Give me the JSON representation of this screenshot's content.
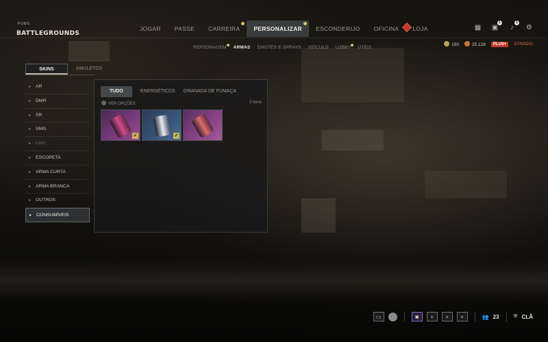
{
  "logo": {
    "small": "PUBG",
    "big": "BATTLEGROUNDS"
  },
  "main_nav": [
    {
      "label": "JOGAR",
      "active": false,
      "dot": false
    },
    {
      "label": "PASSE",
      "active": false,
      "dot": false
    },
    {
      "label": "CARREIRA",
      "active": false,
      "dot": true
    },
    {
      "label": "PERSONALIZAR",
      "active": true,
      "dot": true
    },
    {
      "label": "ESCONDERIJO",
      "active": false,
      "dot": false
    },
    {
      "label": "OFICINA",
      "active": false,
      "dot": false
    },
    {
      "label": "LOJA",
      "active": false,
      "dot": false
    }
  ],
  "top_icons": [
    {
      "name": "grid-icon",
      "glyph": "▦",
      "badge": ""
    },
    {
      "name": "mail-icon",
      "glyph": "▣",
      "badge": "1"
    },
    {
      "name": "bell-icon",
      "glyph": "♪",
      "badge": "1"
    },
    {
      "name": "gear-icon",
      "glyph": "⚙",
      "badge": ""
    }
  ],
  "sub_nav": [
    {
      "label": "PERSONAGEM",
      "active": false,
      "dot": true
    },
    {
      "label": "ARMAS",
      "active": true,
      "dot": false
    },
    {
      "label": "EMOTES E SPRAYS",
      "active": false,
      "dot": false
    },
    {
      "label": "VEÍCULO",
      "active": false,
      "dot": false
    },
    {
      "label": "LOBBY",
      "active": false,
      "dot": true
    },
    {
      "label": "ÚTEIS",
      "active": false,
      "dot": false
    }
  ],
  "currency": {
    "coins": "150",
    "bp": "25.128",
    "plus_label": "PLUS+",
    "plus_status": "ATIVADO"
  },
  "left_tabs": [
    {
      "label": "SKINS",
      "active": true
    },
    {
      "label": "AMULETOS",
      "active": false
    }
  ],
  "categories": [
    {
      "label": "AR",
      "active": false,
      "disabled": false
    },
    {
      "label": "DMR",
      "active": false,
      "disabled": false
    },
    {
      "label": "SR",
      "active": false,
      "disabled": false
    },
    {
      "label": "SMG",
      "active": false,
      "disabled": false
    },
    {
      "label": "LMG",
      "active": false,
      "disabled": true
    },
    {
      "label": "ESCOPETA",
      "active": false,
      "disabled": false
    },
    {
      "label": "ARMA CURTA",
      "active": false,
      "disabled": false
    },
    {
      "label": "ARMA BRANCA",
      "active": false,
      "disabled": false
    },
    {
      "label": "OUTROS",
      "active": false,
      "disabled": false
    },
    {
      "label": "CONSUMÍVEIS",
      "active": true,
      "disabled": false
    }
  ],
  "filter_tabs": [
    {
      "label": "TUDO",
      "active": true
    },
    {
      "label": "ENERGÉTICOS",
      "active": false
    },
    {
      "label": "GRANADA DE FUMAÇA",
      "active": false
    }
  ],
  "options_label": "VER OPÇÕES",
  "item_count": "3 Itens",
  "items": [
    {
      "style": "pink",
      "checked": true
    },
    {
      "style": "blue",
      "checked": true
    },
    {
      "style": "pink2",
      "checked": false
    }
  ],
  "bottom": {
    "friends_count": "23",
    "cla_label": "CLÃ"
  }
}
